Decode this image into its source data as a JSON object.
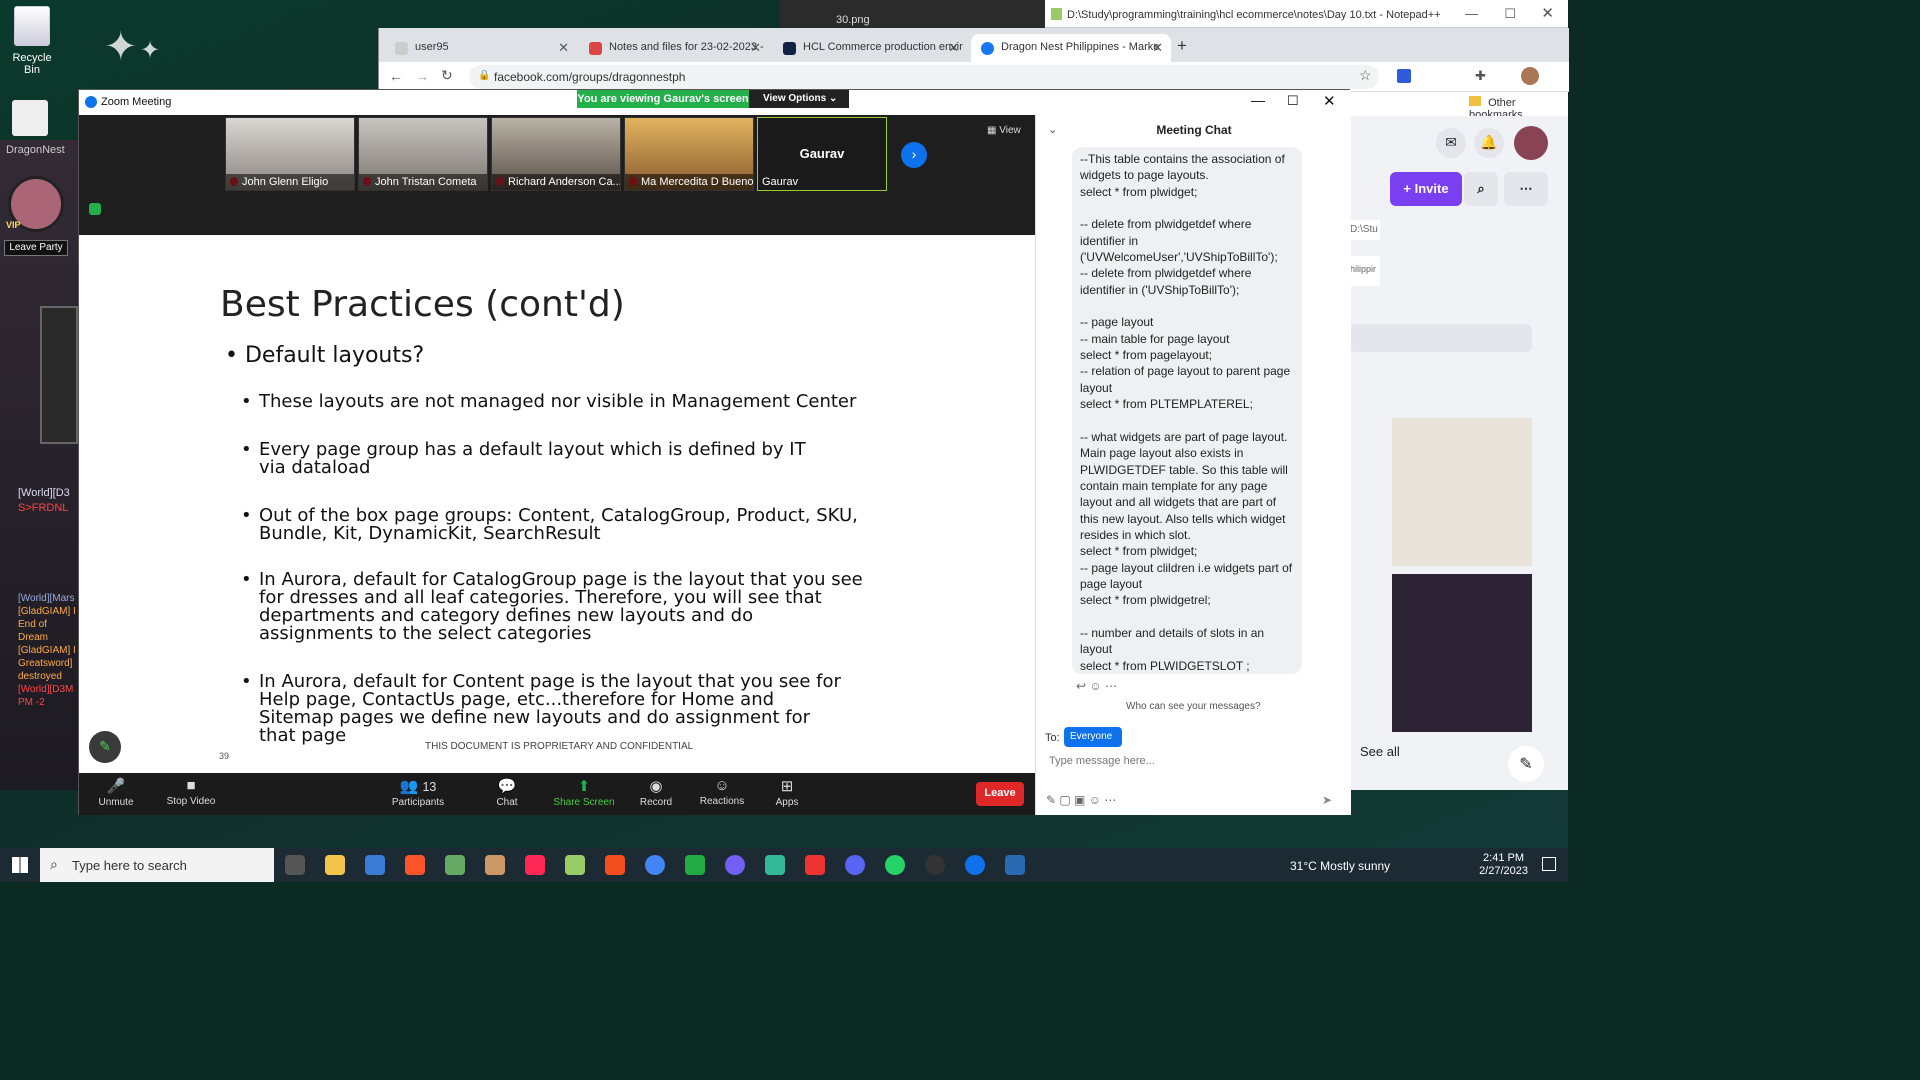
{
  "desktop": {
    "recycle_bin_label": "Recycle Bin",
    "game_label": "DragonNest",
    "vip_label": "VIP",
    "leave_party_label": "Leave Party",
    "chat_lines": [
      "[World][D3",
      "S>FRDNL"
    ],
    "chat_lines2": [
      "[World][Mars",
      "[GladGIAM] I",
      "End of Dream",
      "[GladGIAM] I",
      "Greatsword]",
      "destroyed",
      "[World][D3M",
      "PM -2"
    ]
  },
  "notepad": {
    "title": "D:\\Study\\programming\\training\\hcl ecommerce\\notes\\Day 10.txt - Notepad++"
  },
  "behind_window": {
    "title": "30.png"
  },
  "browser": {
    "tabs": [
      {
        "label": "user95",
        "icon": "generic-icon",
        "active": false
      },
      {
        "label": "Notes and files for 23-02-2023 -",
        "icon": "gmail-icon",
        "active": false
      },
      {
        "label": "HCL Commerce production envir",
        "icon": "hcl-icon",
        "active": false
      },
      {
        "label": "Dragon Nest Philippines - Marke",
        "icon": "facebook-icon",
        "active": true
      }
    ],
    "url": "facebook.com/groups/dragonnestph",
    "bookmarks_label": "Other bookmarks",
    "fb_invite": "+ Invite",
    "fb_see_all": "See all",
    "fb_side_snippets": [
      "D:\\Stu",
      "hilippir"
    ]
  },
  "zoom": {
    "window_title": "Zoom Meeting",
    "viewing_banner": "You are viewing Gaurav's screen",
    "view_options": "View Options",
    "view_label": "View",
    "participants_video": [
      {
        "name": "John Glenn Eligio",
        "muted": true
      },
      {
        "name": "John Tristan Cometa",
        "muted": true
      },
      {
        "name": "Richard Anderson Ca...",
        "muted": true
      },
      {
        "name": "Ma Mercedita D Bueno",
        "muted": true
      },
      {
        "name": "Gaurav",
        "muted": false,
        "display": "Gaurav"
      }
    ],
    "slide": {
      "title": "Best Practices (cont'd)",
      "level1": "Default layouts?",
      "bullets": [
        "These layouts are not managed nor visible in Management Center",
        "Every page group has a default layout which is defined by IT via dataload",
        "Out of the box page groups: Content, CatalogGroup, Product, SKU, Bundle, Kit, DynamicKit, SearchResult",
        "In Aurora, default for CatalogGroup page is the layout that you see for dresses and all leaf categories. Therefore, you will see that departments and category defines new layouts and do assignments to the select categories",
        "In Aurora, default for Content page is the layout that you see for Help page, ContactUs page, etc...therefore for Home and Sitemap pages we define new layouts and do assignment for that page"
      ],
      "footer": "THIS DOCUMENT IS PROPRIETARY AND CONFIDENTIAL",
      "zoom_level": "39"
    },
    "toolbar": {
      "unmute": "Unmute",
      "stop_video": "Stop Video",
      "participants": "Participants",
      "participants_count": "13",
      "chat": "Chat",
      "share_screen": "Share Screen",
      "record": "Record",
      "reactions": "Reactions",
      "apps": "Apps",
      "leave": "Leave"
    },
    "chat": {
      "header": "Meeting Chat",
      "message": "--This table contains the association of widgets to page layouts.\nselect * from plwidget;\n\n-- delete from plwidgetdef where identifier in ('UVWelcomeUser','UVShipToBillTo');\n-- delete from plwidgetdef where identifier in ('UVShipToBillTo');\n\n-- page layout\n-- main table for page layout\nselect * from pagelayout;\n-- relation of page layout to parent page layout\nselect * from PLTEMPLATEREL;\n\n-- what widgets are part of page layout. Main page layout also exists in PLWIDGETDEF table. So this table will contain main template for any page layout and all widgets that are part of this new layout. Also tells which widget resides in which slot.\nselect * from plwidget;\n-- page layout clildren i.e widgets part of page layout\nselect * from plwidgetrel;\n\n-- number and details of slots in an layout\nselect * from PLWIDGETSLOT ;",
      "who_can_see": "Who can see your messages?",
      "to_label": "To:",
      "recipient": "Everyone",
      "placeholder": "Type message here..."
    }
  },
  "taskbar": {
    "search_placeholder": "Type here to search",
    "weather": "31°C  Mostly sunny",
    "time": "2:41 PM",
    "date": "2/27/2023"
  },
  "colors": {
    "zoom_green": "#23b04a",
    "zoom_blue": "#0e72ed",
    "leave_red": "#e02828",
    "fb_purple": "#7b3ff2"
  }
}
